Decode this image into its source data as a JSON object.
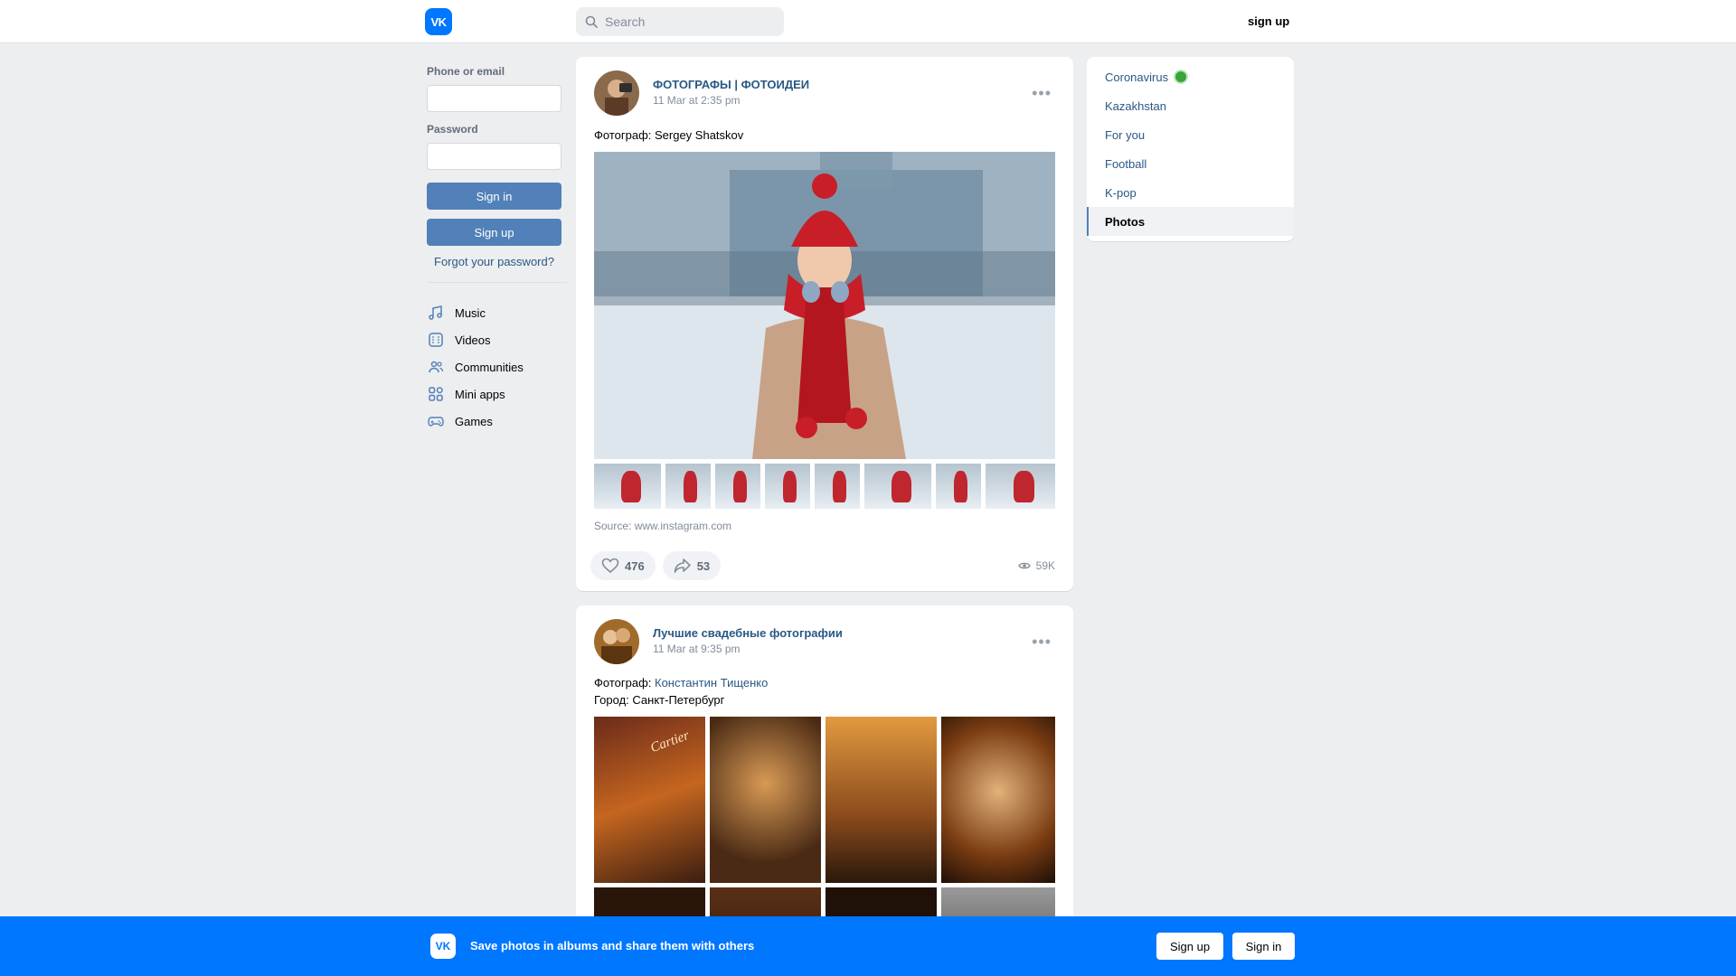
{
  "header": {
    "logo": "VK",
    "search_placeholder": "Search",
    "signup_label": "sign up"
  },
  "login": {
    "phone_label": "Phone or email",
    "password_label": "Password",
    "signin_label": "Sign in",
    "signup_label": "Sign up",
    "forgot_label": "Forgot your password?"
  },
  "nav": {
    "items": [
      {
        "label": "Music",
        "icon": "music-icon"
      },
      {
        "label": "Videos",
        "icon": "videos-icon"
      },
      {
        "label": "Communities",
        "icon": "communities-icon"
      },
      {
        "label": "Mini apps",
        "icon": "mini-apps-icon"
      },
      {
        "label": "Games",
        "icon": "games-icon"
      }
    ]
  },
  "posts": [
    {
      "author": "ФОТОГРАФЫ | ФОТОИДЕИ",
      "date": "11 Mar at 2:35 pm",
      "text": "Фотограф: Sergey Shatskov",
      "source": "Source: www.instagram.com",
      "likes": "476",
      "shares": "53",
      "views": "59K"
    },
    {
      "author": "Лучшие свадебные фотографии",
      "date": "11 Mar at 9:35 pm",
      "text_prefix": "Фотограф: ",
      "photographer": "Константин Тищенко",
      "city": "Город: Санкт-Петербург",
      "sign_text": "Cartier"
    }
  ],
  "right_menu": {
    "items": [
      "Coronavirus",
      "Kazakhstan",
      "For you",
      "Football",
      "K-pop",
      "Photos"
    ],
    "active": "Photos"
  },
  "bottom_bar": {
    "logo": "VK",
    "text": "Save photos in albums and share them with others",
    "signup_label": "Sign up",
    "signin_label": "Sign in"
  },
  "colors": {
    "accent": "#0077ff",
    "button": "#5181b8",
    "link": "#2a5885",
    "background": "#edeef0"
  }
}
